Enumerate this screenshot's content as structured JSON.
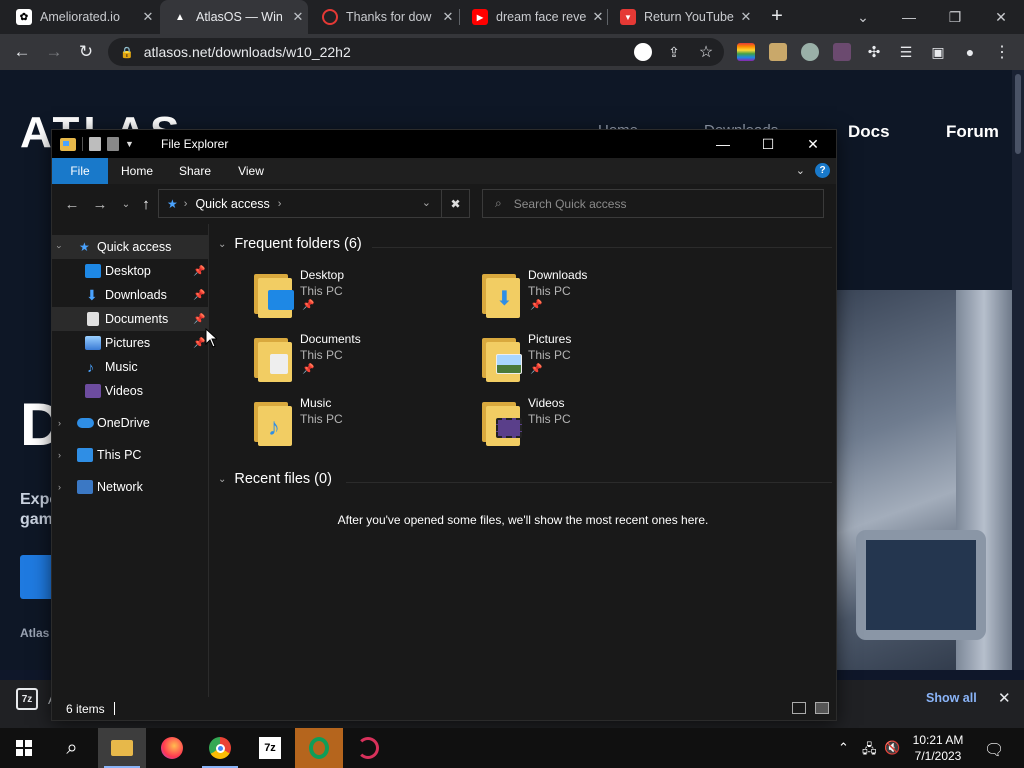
{
  "browser": {
    "tabs": [
      {
        "title": "Ameliorated.io",
        "close": "✕"
      },
      {
        "title": "AtlasOS — Win",
        "close": "✕"
      },
      {
        "title": "Thanks for dow",
        "close": "✕"
      },
      {
        "title": "dream face reve",
        "close": "✕"
      },
      {
        "title": "Return YouTube",
        "close": "✕"
      }
    ],
    "new_tab": "+",
    "url": "atlasos.net/downloads/w10_22h2"
  },
  "site": {
    "logo": "ATLAS",
    "nav": [
      "Home",
      "Downloads",
      "Docs",
      "Forum"
    ],
    "hero_letter": "D",
    "hero_text_1": "Expe",
    "hero_text_2": "gam",
    "footer": "Atlas"
  },
  "download_shelf": {
    "file_letter": "A",
    "show_all": "Show all",
    "close": "✕"
  },
  "explorer": {
    "title": "File Explorer",
    "ribbon_tabs": [
      "File",
      "Home",
      "Share",
      "View"
    ],
    "address": "Quick access",
    "search_placeholder": "Search Quick access",
    "nav": {
      "quick_access": "Quick access",
      "items": [
        "Desktop",
        "Downloads",
        "Documents",
        "Pictures",
        "Music",
        "Videos"
      ],
      "onedrive": "OneDrive",
      "this_pc": "This PC",
      "network": "Network"
    },
    "frequent_header": "Frequent folders (6)",
    "folders": [
      {
        "name": "Desktop",
        "location": "This PC",
        "pinned": true
      },
      {
        "name": "Downloads",
        "location": "This PC",
        "pinned": true
      },
      {
        "name": "Documents",
        "location": "This PC",
        "pinned": true
      },
      {
        "name": "Pictures",
        "location": "This PC",
        "pinned": true
      },
      {
        "name": "Music",
        "location": "This PC",
        "pinned": false
      },
      {
        "name": "Videos",
        "location": "This PC",
        "pinned": false
      }
    ],
    "recent_header": "Recent files (0)",
    "recent_empty": "After you've opened some files, we'll show the most recent ones here.",
    "status_count": "6 items"
  },
  "taskbar": {
    "time": "10:21 AM",
    "date": "7/1/2023"
  }
}
